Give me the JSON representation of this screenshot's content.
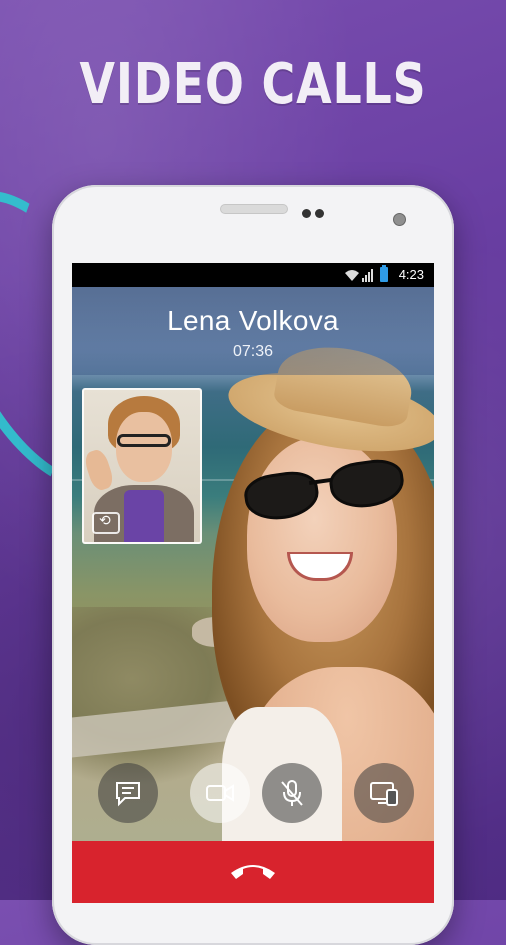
{
  "promo": {
    "headline": "VIDEO CALLS"
  },
  "statusbar": {
    "time": "4:23",
    "icons": [
      "wifi-icon",
      "signal-icon",
      "battery-icon"
    ]
  },
  "call": {
    "contact_name": "Lena Volkova",
    "duration": "07:36"
  },
  "controls": {
    "buttons": [
      {
        "icon": "chat-icon"
      },
      {
        "icon": "video-camera-icon",
        "active": true
      },
      {
        "icon": "mute-mic-icon"
      },
      {
        "icon": "screen-share-icon"
      }
    ],
    "end_call_icon": "phone-hangup-icon",
    "end_call_color": "#d8232d"
  },
  "colors": {
    "background": "#6a3fa3",
    "accent_swoosh": "#31c2cf"
  }
}
